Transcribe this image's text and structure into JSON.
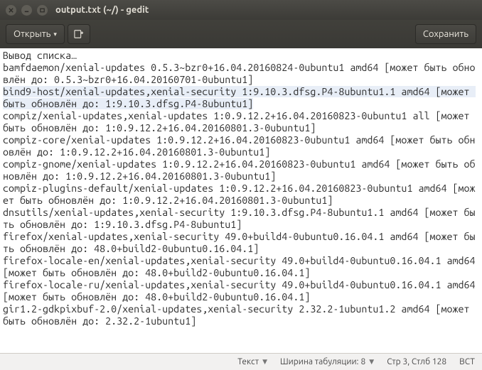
{
  "window": {
    "title": "output.txt (~/) - gedit"
  },
  "toolbar": {
    "open_label": "Открыть",
    "save_label": "Сохранить"
  },
  "text": {
    "l0": "Вывод списка…",
    "l1": "bamfdaemon/xenial-updates 0.5.3~bzr0+16.04.20160824-0ubuntu1 amd64 [может быть обновлён до: 0.5.3~bzr0+16.04.20160701-0ubuntu1]",
    "l2a": "bind9-host/xenial-updates,xenial-security 1:9.10.3.dfsg.P4-8ubuntu1.1 amd64 [может быть обновлён до: 1:9.10.3.dfsg.P4-8ubuntu1]",
    "l3": "compiz/xenial-updates,xenial-updates 1:0.9.12.2+16.04.20160823-0ubuntu1 all [может быть обновлён до: 1:0.9.12.2+16.04.20160801.3-0ubuntu1]",
    "l4": "compiz-core/xenial-updates 1:0.9.12.2+16.04.20160823-0ubuntu1 amd64 [может быть обновлён до: 1:0.9.12.2+16.04.20160801.3-0ubuntu1]",
    "l5": "compiz-gnome/xenial-updates 1:0.9.12.2+16.04.20160823-0ubuntu1 amd64 [может быть обновлён до: 1:0.9.12.2+16.04.20160801.3-0ubuntu1]",
    "l6": "compiz-plugins-default/xenial-updates 1:0.9.12.2+16.04.20160823-0ubuntu1 amd64 [может быть обновлён до: 1:0.9.12.2+16.04.20160801.3-0ubuntu1]",
    "l7": "dnsutils/xenial-updates,xenial-security 1:9.10.3.dfsg.P4-8ubuntu1.1 amd64 [может быть обновлён до: 1:9.10.3.dfsg.P4-8ubuntu1]",
    "l8": "firefox/xenial-updates,xenial-security 49.0+build4-0ubuntu0.16.04.1 amd64 [может быть обновлён до: 48.0+build2-0ubuntu0.16.04.1]",
    "l9": "firefox-locale-en/xenial-updates,xenial-security 49.0+build4-0ubuntu0.16.04.1 amd64 [может быть обновлён до: 48.0+build2-0ubuntu0.16.04.1]",
    "l10": "firefox-locale-ru/xenial-updates,xenial-security 49.0+build4-0ubuntu0.16.04.1 amd64 [может быть обновлён до: 48.0+build2-0ubuntu0.16.04.1]",
    "l11": "gir1.2-gdkpixbuf-2.0/xenial-updates,xenial-security 2.32.2-1ubuntu1.2 amd64 [может быть обновлён до: 2.32.2-1ubuntu1]"
  },
  "status": {
    "syntax": "Текст",
    "tabwidth_label": "Ширина табуляции:",
    "tabwidth_value": "8",
    "cursor": "Стр 3, Стлб 128",
    "insert_mode": "ВСТ"
  }
}
